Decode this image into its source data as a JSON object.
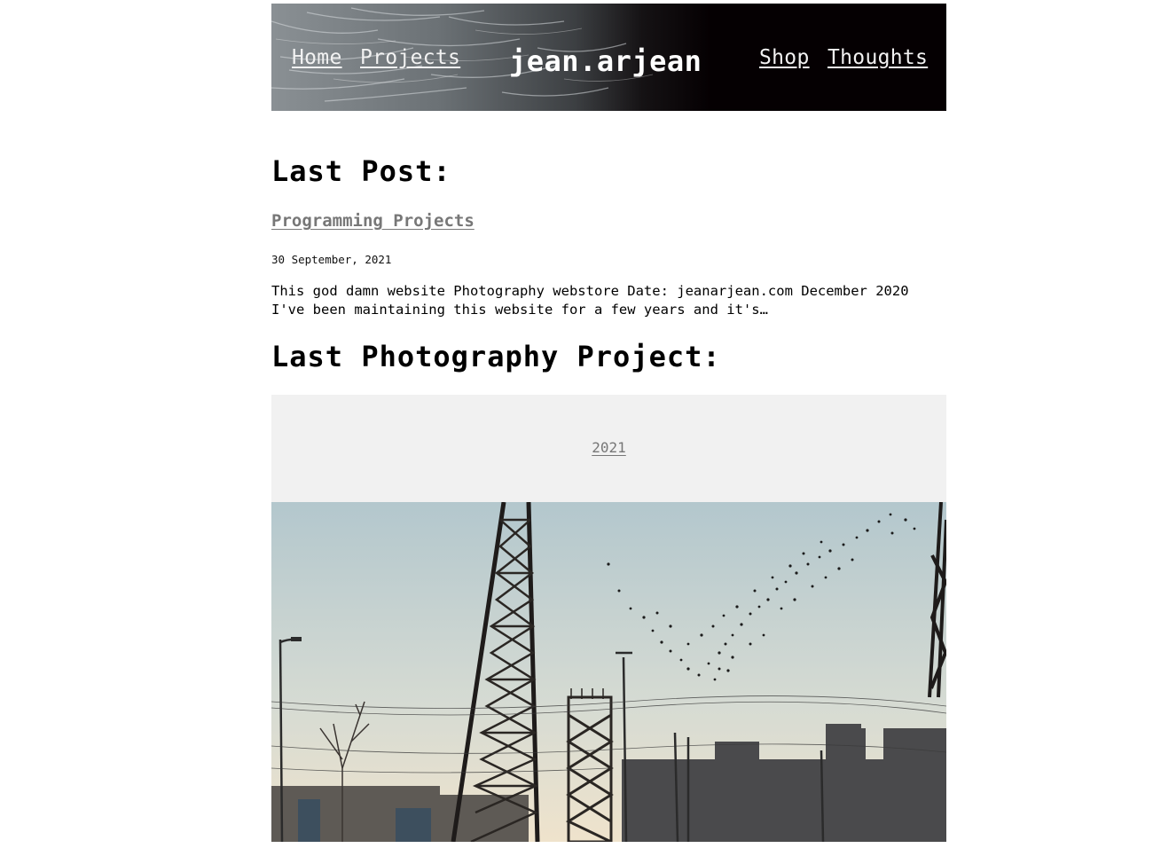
{
  "header": {
    "nav_left": [
      {
        "label": "Home"
      },
      {
        "label": "Projects"
      }
    ],
    "site_title": "jean.arjean",
    "nav_right": [
      {
        "label": "Shop"
      },
      {
        "label": "Thoughts"
      }
    ],
    "banner_icon": "eye-fur-photo"
  },
  "main": {
    "last_post_heading": "Last Post:",
    "post": {
      "title": "Programming Projects",
      "date": "30 September, 2021",
      "excerpt": "This god damn website Photography webstore Date: jeanarjean.com December 2020 I've been maintaining this website for a few years and it's…"
    },
    "last_photo_heading": "Last Photography Project:",
    "project": {
      "year": "2021",
      "photo_icon": "industrial-skyline-with-birds-photo"
    }
  },
  "colors": {
    "banner_bg": "#050002",
    "link_muted": "#777777",
    "year_box_bg": "#f1f1f1",
    "sky_top": "#b5c9cf",
    "sky_bottom": "#efe6d3"
  }
}
